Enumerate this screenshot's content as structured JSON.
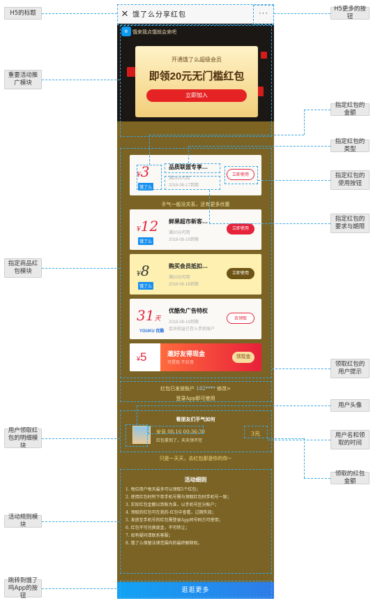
{
  "titlebar": {
    "close_icon": "close-icon",
    "title": "饿了么分享红包",
    "more": "···"
  },
  "banner": {
    "slogan": "饿来我点饿就会来吧",
    "subtitle": "开通饿了么超级会员",
    "headline": "即领20元无门槛红包",
    "cta": "立即加入"
  },
  "coupons": [
    {
      "amount": "3",
      "unit": "¥",
      "tag": "饿了么",
      "title": "品质联盟专享…",
      "line1": "满25元可用",
      "line2": "2018-08-17到期",
      "button": "立即使用",
      "style": "outline"
    },
    {
      "amount": "12",
      "unit": "¥",
      "tag": "饿了么",
      "title": "鲜果超市新客…",
      "line1": "满20元可用",
      "line2": "2018-08-16到期",
      "button": "立即使用",
      "style": "red"
    },
    {
      "amount": "8",
      "unit": "¥",
      "tag": "饿了么",
      "title": "购买会员抵扣…",
      "line1": "满20元可用",
      "line2": "2018-08-16到期",
      "button": "立即使用",
      "style": "brown"
    },
    {
      "amount": "31",
      "unit": "天",
      "tag": "YOUKU 优酷",
      "title": "优酷免广告特权",
      "line1": "2018-08-16到期",
      "line2": "会员权益已存入手机账户",
      "button": "去领取",
      "style": "outline"
    }
  ],
  "notes": {
    "luck": "手气一般没关系，还有更多优惠",
    "user_tip": "红包已发放账户",
    "user_phone": "182****",
    "change": "修改>",
    "app_tip": "登录App即可使用"
  },
  "invite": {
    "amount": "5",
    "unit": "¥",
    "title": "邀好友得现金",
    "sub": "可提现 不封顶",
    "button": "领现金"
  },
  "records": {
    "heading": "看朋友们手气如何",
    "name": "安息",
    "time": "08.16 00:36:30",
    "msg": "红包拿到了，天天领不完",
    "amount": "3元"
  },
  "footer_note": "只是一天天，去红包那是你的你~",
  "rules": {
    "title": "活动细则",
    "items": [
      "1. 每位用户每天最多可以领取5个红包；",
      "2. 使用红包时所下单手机号需与领取红包时手机号一致；",
      "3. 实际红包金额以到账为准，以手机号区分账户；",
      "4. 领取的红包可在我的-红包中查看，过期失效；",
      "5. 发放至手机号的红包需登录App同号码方可使用；",
      "6. 红包不可兑换现金，不可转让；",
      "7. 如有疑问请联系客服；",
      "8. 饿了么保留法律范围内的最终解释权。"
    ]
  },
  "bottom_button": "逛逛更多",
  "annotations": {
    "title": "H5的标题",
    "more": "H5更多的按钮",
    "promo": "重要活动推广模块",
    "amount": "指定红包的金额",
    "type": "指定红包的类型",
    "use": "指定红包的使用按钮",
    "req": "指定红包的要求与期限",
    "product": "指定商品红包模块",
    "user_tip": "领取红包的用户提示",
    "avatar": "用户头像",
    "name_time": "用户名和领取的时间",
    "detail": "用户领取红包的明细模块",
    "amount_recv": "领取的红包金额",
    "rules": "活动规则模块",
    "jump": "跳转到饿了吗App的按钮"
  },
  "colors": {
    "accent_blue": "#168ef0",
    "brand_red": "#e5233a",
    "bg_brown": "#7a6325",
    "annotation_line": "#3ba6e0"
  }
}
